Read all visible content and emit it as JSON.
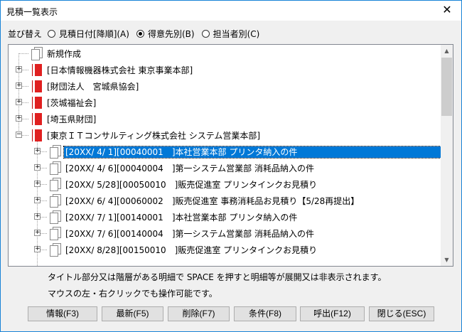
{
  "window": {
    "title": "見積一覧表示",
    "close_glyph": "✕"
  },
  "sort": {
    "label": "並び替え",
    "options": [
      {
        "label": "見積日付[降順](A)",
        "checked": false
      },
      {
        "label": "得意先別(B)",
        "checked": true
      },
      {
        "label": "担当者別(C)",
        "checked": false
      }
    ]
  },
  "tree": {
    "rows": [
      {
        "level": 0,
        "expander": "",
        "icon": "document-icon",
        "label": "新規作成",
        "selected": false
      },
      {
        "level": 0,
        "expander": "+",
        "icon": "book-icon",
        "label": "[日本情報機器株式会社 東京事業本部]",
        "selected": false
      },
      {
        "level": 0,
        "expander": "+",
        "icon": "book-icon",
        "label": "[財団法人　宮城県協会]",
        "selected": false
      },
      {
        "level": 0,
        "expander": "+",
        "icon": "book-icon",
        "label": "[茨城福祉会]",
        "selected": false
      },
      {
        "level": 0,
        "expander": "+",
        "icon": "book-icon",
        "label": "[埼玉県財団]",
        "selected": false
      },
      {
        "level": 0,
        "expander": "−",
        "icon": "book-icon",
        "label": "[東京ＩＴコンサルティング株式会社 システム営業本部]",
        "selected": false
      },
      {
        "level": 1,
        "expander": "+",
        "icon": "document-icon",
        "label": "[20XX/ 4/ 1][00040001　]本社営業本部 プリンタ納入の件",
        "selected": true
      },
      {
        "level": 1,
        "expander": "+",
        "icon": "document-icon",
        "label": "[20XX/ 4/ 6][00040004　]第一システム営業部 消耗品納入の件",
        "selected": false
      },
      {
        "level": 1,
        "expander": "+",
        "icon": "document-icon",
        "label": "[20XX/ 5/28][00050010　]販売促進室 プリンタインクお見積り",
        "selected": false
      },
      {
        "level": 1,
        "expander": "+",
        "icon": "document-icon",
        "label": "[20XX/ 6/ 4][00060002　]販売促進室 事務消耗品お見積り【5/28再提出】",
        "selected": false
      },
      {
        "level": 1,
        "expander": "+",
        "icon": "document-icon",
        "label": "[20XX/ 7/ 1][00140001　]本社営業本部 プリンタ納入の件",
        "selected": false
      },
      {
        "level": 1,
        "expander": "+",
        "icon": "document-icon",
        "label": "[20XX/ 7/ 6][00140004　]第一システム営業部 消耗品納入の件",
        "selected": false
      },
      {
        "level": 1,
        "expander": "+",
        "icon": "document-icon",
        "label": "[20XX/ 8/28][00150010　]販売促進室 プリンタインクお見積り",
        "selected": false
      }
    ]
  },
  "info": {
    "line1": "タイトル部分又は階層がある明細で SPACE を押すと明細等が展開又は非表示されます。",
    "line2": "マウスの左・右クリックでも操作可能です。"
  },
  "buttons": [
    {
      "name": "info-button",
      "label": "情報(F3)"
    },
    {
      "name": "refresh-button",
      "label": "最新(F5)"
    },
    {
      "name": "delete-button",
      "label": "削除(F7)"
    },
    {
      "name": "condition-button",
      "label": "条件(F8)"
    },
    {
      "name": "call-button",
      "label": "呼出(F12)"
    },
    {
      "name": "close-button",
      "label": "閉じる(ESC)"
    }
  ],
  "colors": {
    "selection": "#0078d7",
    "book_icon": "#e02020",
    "window_border": "#1883d7"
  }
}
